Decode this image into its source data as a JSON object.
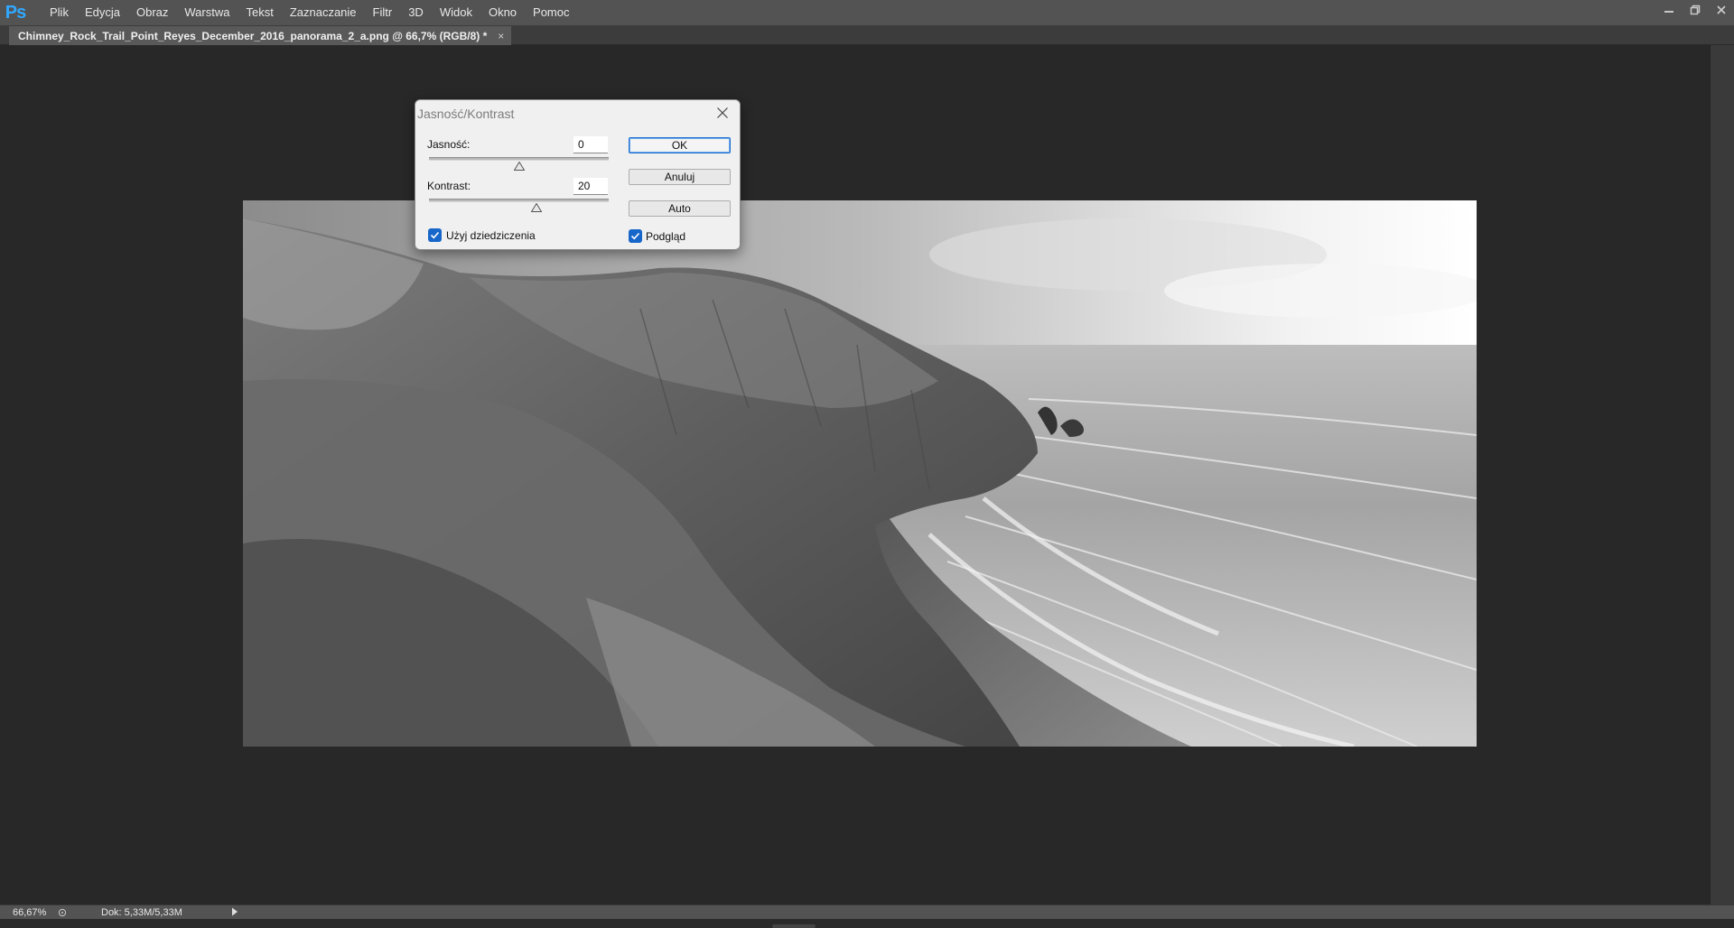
{
  "app": {
    "logo_text": "Ps",
    "accent": "#31a8ff"
  },
  "menu": {
    "items": [
      "Plik",
      "Edycja",
      "Obraz",
      "Warstwa",
      "Tekst",
      "Zaznaczanie",
      "Filtr",
      "3D",
      "Widok",
      "Okno",
      "Pomoc"
    ]
  },
  "window_controls": {
    "icons": [
      "minimize-icon",
      "restore-icon",
      "close-icon"
    ]
  },
  "document_tab": {
    "title": "Chimney_Rock_Trail_Point_Reyes_December_2016_panorama_2_a.png @ 66,7% (RGB/8) *",
    "close_glyph": "×"
  },
  "dialog": {
    "title": "Jasność/Kontrast",
    "brightness": {
      "label": "Jasność:",
      "value": "0",
      "slider_fraction": 0.5
    },
    "contrast": {
      "label": "Kontrast:",
      "value": "20",
      "slider_fraction": 0.6
    },
    "buttons": {
      "ok": "OK",
      "cancel": "Anuluj",
      "auto": "Auto"
    },
    "use_legacy": {
      "label": "Użyj dziedziczenia",
      "checked": true
    },
    "preview": {
      "label": "Podgląd",
      "checked": true
    },
    "checkbox_color": "#1766c9"
  },
  "status_bar": {
    "zoom": "66,67%",
    "doc_size": "Dok: 5,33M/5,33M"
  }
}
